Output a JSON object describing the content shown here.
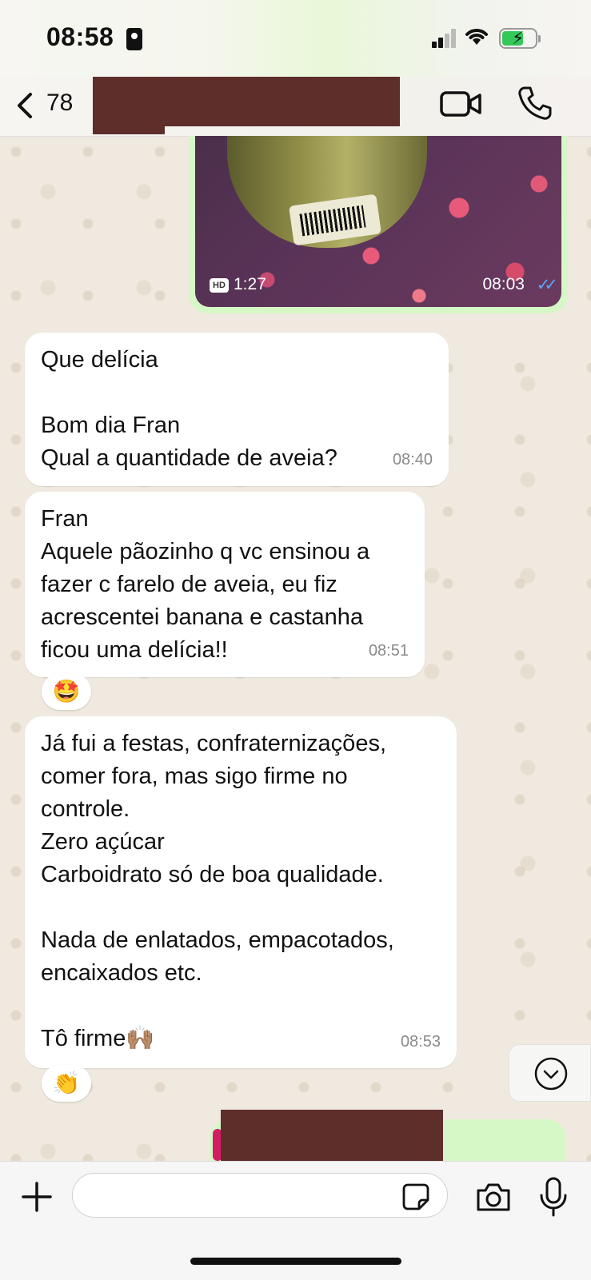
{
  "status": {
    "time": "08:58"
  },
  "header": {
    "back_count": "78"
  },
  "video_message": {
    "hd_label": "HD",
    "duration": "1:27",
    "time": "08:03"
  },
  "messages": [
    {
      "text": "Que delícia\n\nBom dia Fran\nQual a quantidade de aveia?",
      "time": "08:40"
    },
    {
      "text": "Fran\nAquele pãozinho q vc ensinou a fazer c farelo de aveia, eu fiz acrescentei banana e castanha ficou uma delícia!!",
      "time": "08:51",
      "reaction": "🤩"
    },
    {
      "text": "Já fui a festas, confraternizações, comer fora, mas sigo firme no controle.\nZero açúcar\nCarboidrato só de boa qualidade.\n\nNada de enlatados, empacotados, encaixados etc.\n\nTô firme🙌🏽",
      "time": "08:53",
      "reaction": "👏"
    }
  ],
  "colors": {
    "outgoing_bubble": "#d6f8c6",
    "incoming_bubble": "#ffffff",
    "read_check": "#5aa5ff",
    "redaction": "#5e2e2b"
  }
}
